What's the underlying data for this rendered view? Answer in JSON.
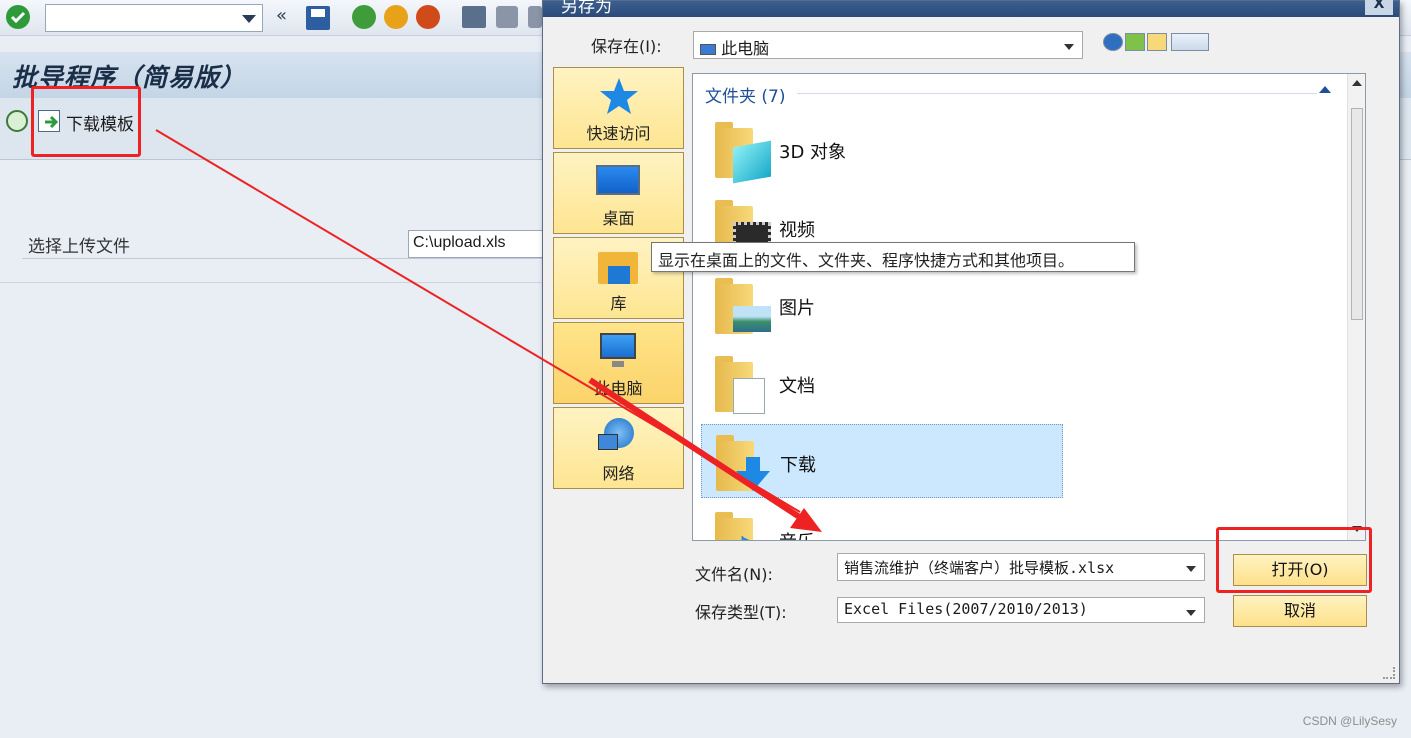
{
  "sap": {
    "program_title": "批导程序（简易版）",
    "download_template_label": "下载模板",
    "select_file_label": "选择上传文件",
    "upload_path": "C:\\upload.xls"
  },
  "dialog": {
    "title": "另存为",
    "close_glyph": "X",
    "save_in_label": "保存在(I):",
    "save_in_value": "此电脑",
    "places": [
      {
        "label": "快速访问",
        "icon": "star-icon"
      },
      {
        "label": "桌面",
        "icon": "desktop-icon"
      },
      {
        "label": "库",
        "icon": "library-icon"
      },
      {
        "label": "此电脑",
        "icon": "computer-icon"
      },
      {
        "label": "网络",
        "icon": "network-icon"
      }
    ],
    "section_header": "文件夹 (7)",
    "folders": [
      {
        "name": "3D 对象",
        "icon": "3d-objects-icon"
      },
      {
        "name": "视频",
        "icon": "video-icon"
      },
      {
        "name": "图片",
        "icon": "pictures-icon"
      },
      {
        "name": "文档",
        "icon": "documents-icon"
      },
      {
        "name": "下载",
        "icon": "downloads-icon",
        "selected": true
      },
      {
        "name": "音乐",
        "icon": "music-icon"
      }
    ],
    "tooltip": "显示在桌面上的文件、文件夹、程序快捷方式和其他项目。",
    "filename_label": "文件名(N):",
    "filename_value": "销售流维护（终端客户）批导模板.xlsx",
    "filetype_label": "保存类型(T):",
    "filetype_value": "Excel Files(2007/2010/2013)",
    "open_button": "打开(O)",
    "cancel_button": "取消"
  },
  "watermark": "CSDN @LilySesy",
  "colors": {
    "highlight": "#ee2222",
    "places_bg": "#fde591",
    "selection": "#cce8ff"
  }
}
